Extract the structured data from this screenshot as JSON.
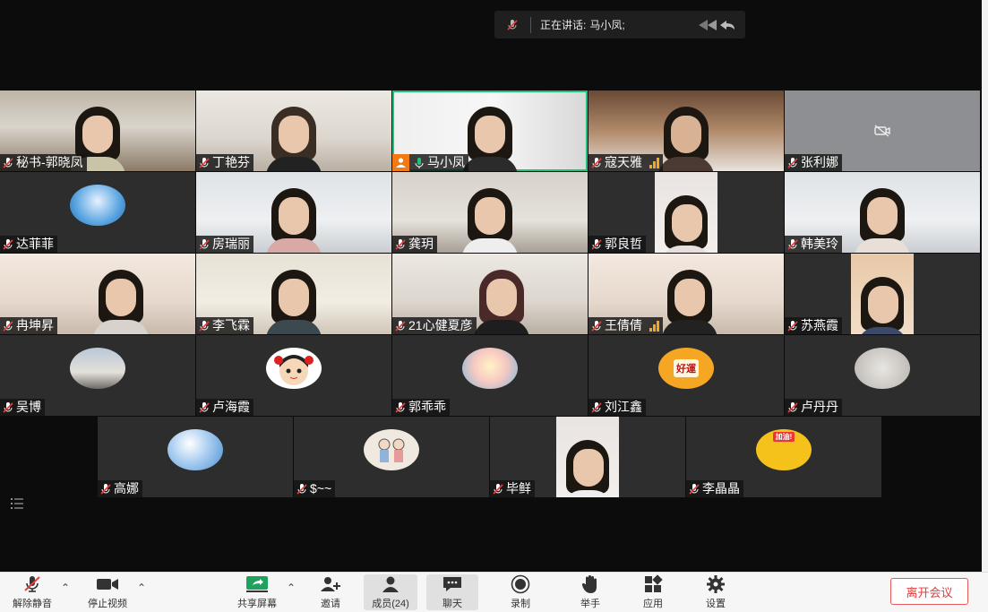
{
  "speaking": {
    "prefix": "正在讲话: ",
    "speaker": "马小凤;"
  },
  "participants": [
    {
      "name": "秘书-郭晓凤",
      "video": "camera"
    },
    {
      "name": "丁艳芬",
      "video": "camera"
    },
    {
      "name": "马小凤",
      "video": "camera",
      "host": true,
      "speaking": true
    },
    {
      "name": "寇天雅",
      "video": "camera",
      "signal": true
    },
    {
      "name": "张利娜",
      "video": "off"
    },
    {
      "name": "达菲菲",
      "video": "avatar"
    },
    {
      "name": "房瑞丽",
      "video": "camera"
    },
    {
      "name": "龚玥",
      "video": "camera"
    },
    {
      "name": "郭良哲",
      "video": "camera"
    },
    {
      "name": "韩美玲",
      "video": "camera"
    },
    {
      "name": "冉坤昇",
      "video": "camera"
    },
    {
      "name": "李飞霖",
      "video": "camera"
    },
    {
      "name": "21心健夏彦",
      "video": "camera"
    },
    {
      "name": "王倩倩",
      "video": "camera",
      "signal": true
    },
    {
      "name": "苏燕霞",
      "video": "camera"
    },
    {
      "name": "吴博",
      "video": "avatar"
    },
    {
      "name": "卢海霞",
      "video": "avatar"
    },
    {
      "name": "郭乖乖",
      "video": "avatar"
    },
    {
      "name": "刘江鑫",
      "video": "avatar"
    },
    {
      "name": "卢丹丹",
      "video": "avatar"
    },
    {
      "name": "高娜",
      "video": "avatar"
    },
    {
      "name": "$~~",
      "video": "avatar"
    },
    {
      "name": "毕鲜",
      "video": "camera"
    },
    {
      "name": "李晶晶",
      "video": "avatar"
    }
  ],
  "avatar_text": {
    "luck": "好運",
    "yellow": "加油!"
  },
  "toolbar": {
    "unmute": "解除静音",
    "stop_video": "停止视频",
    "share_screen": "共享屏幕",
    "invite": "邀请",
    "members": "成员(24)",
    "chat": "聊天",
    "record": "录制",
    "raise_hand": "举手",
    "apps": "应用",
    "settings": "设置",
    "leave": "离开会议"
  },
  "colors": {
    "accent_green": "#1ec27a",
    "host_orange": "#f07a17",
    "leave_red": "#e23b3b",
    "muted_red": "#e04040"
  }
}
